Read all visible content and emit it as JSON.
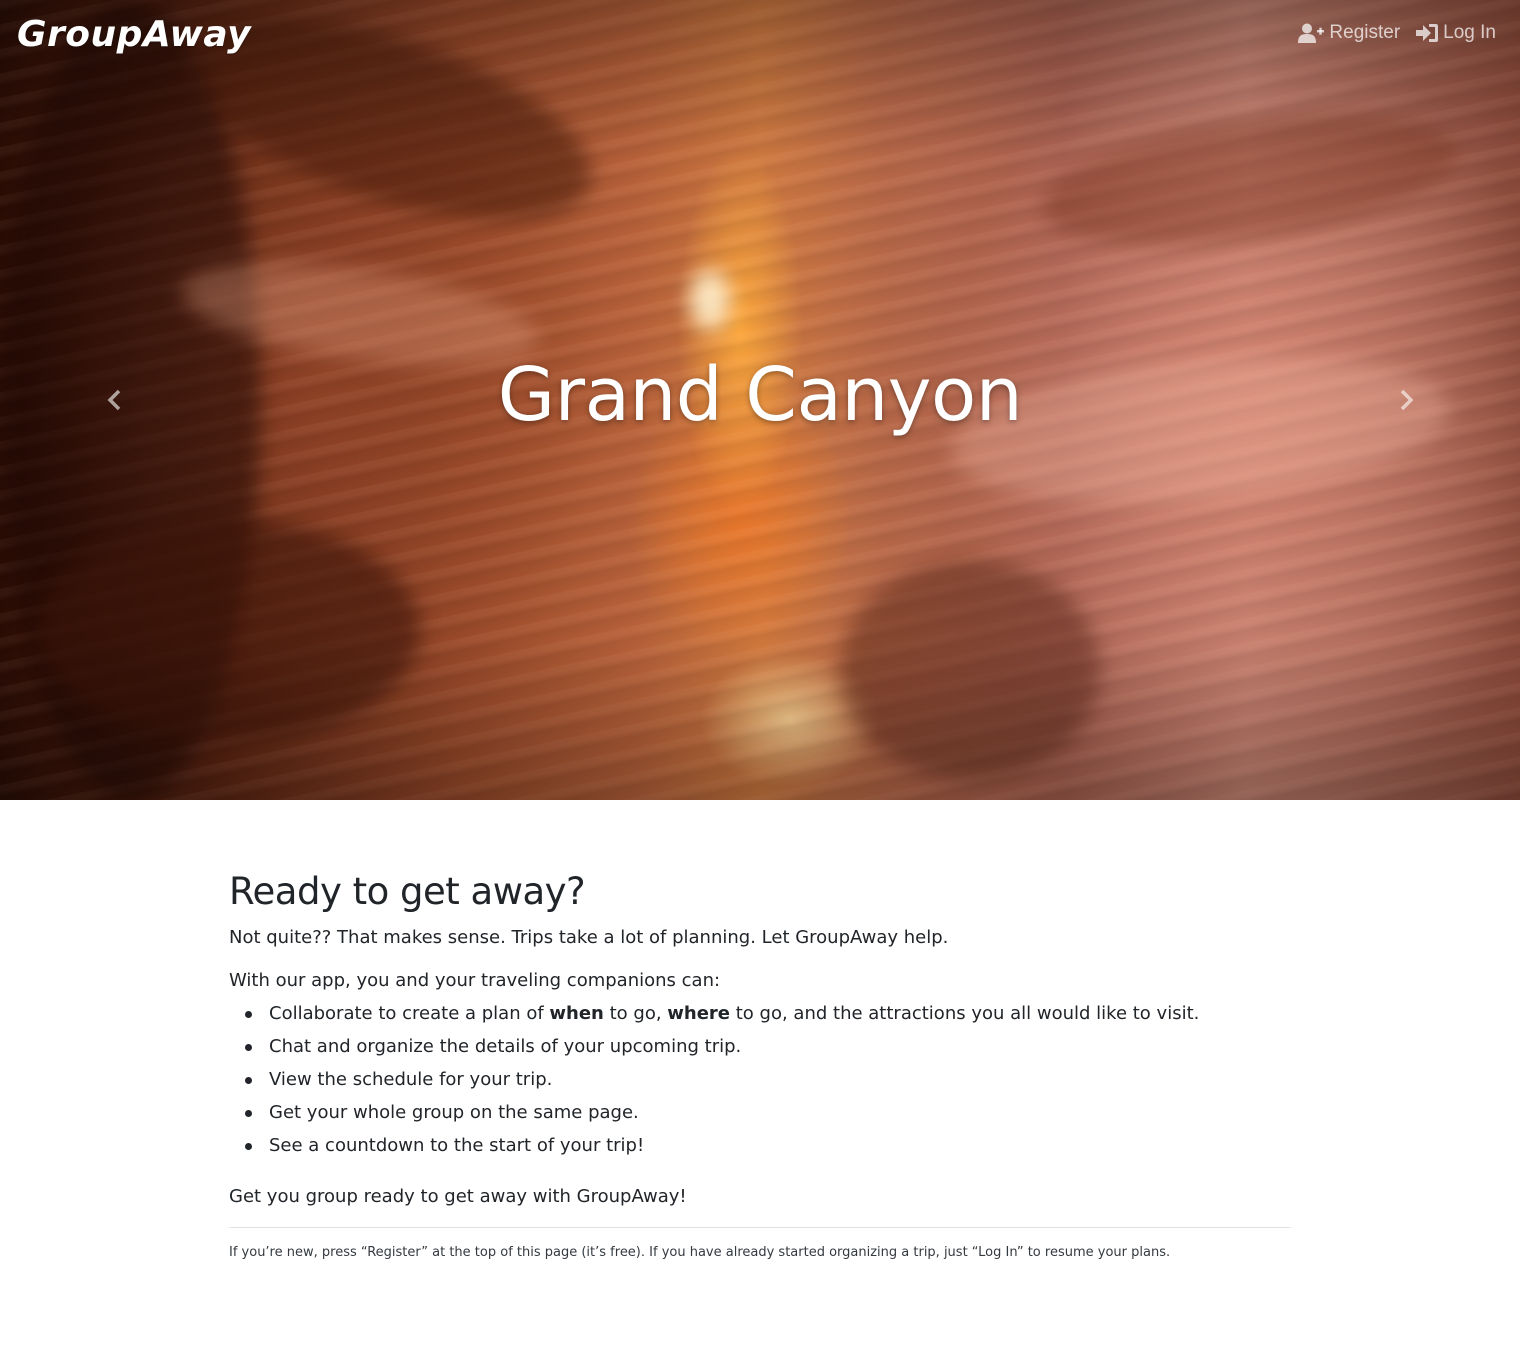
{
  "navbar": {
    "brand": "GroupAway",
    "register_label": "Register",
    "login_label": "Log In",
    "register_icon": "user-plus-icon",
    "login_icon": "sign-in-icon"
  },
  "carousel": {
    "slide_title": "Grand Canyon",
    "prev_icon": "chevron-left-icon",
    "next_icon": "chevron-right-icon"
  },
  "main": {
    "heading": "Ready to get away?",
    "lead": "Not quite?? That makes sense. Trips take a lot of planning. Let GroupAway help.",
    "intro": "With our app, you and your traveling companions can:",
    "features": {
      "f1_pre": "Collaborate to create a plan of ",
      "f1_when": "when",
      "f1_mid": " to go, ",
      "f1_where": "where",
      "f1_post": " to go, and the attractions you all would like to visit.",
      "f2": "Chat and organize the details of your upcoming trip.",
      "f3": "View the schedule for your trip.",
      "f4": "Get your whole group on the same page.",
      "f5": "See a countdown to the start of your trip!"
    },
    "closing": "Get you group ready to get away with GroupAway!",
    "footnote": "If you’re new, press “Register” at the top of this page (it’s free). If you have already started organizing a trip, just “Log In” to resume your plans."
  }
}
